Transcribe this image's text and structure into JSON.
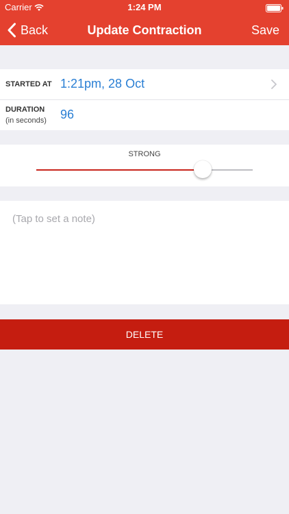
{
  "status_bar": {
    "carrier": "Carrier",
    "time": "1:24 PM"
  },
  "nav": {
    "back_label": "Back",
    "title": "Update Contraction",
    "save_label": "Save"
  },
  "contraction": {
    "started_label": "STARTED AT",
    "started_value": "1:21pm, 28 Oct",
    "duration_label": "DURATION",
    "duration_sublabel": "(in seconds)",
    "duration_value": "96"
  },
  "intensity": {
    "label": "STRONG",
    "level": 0.77
  },
  "note": {
    "placeholder": "(Tap to set a note)"
  },
  "delete_label": "DELETE",
  "colors": {
    "nav_background": "#e4412f",
    "accent_blue": "#2a7fd4",
    "delete_red": "#c51d10",
    "slider_fill": "#c8241b",
    "background": "#efeff4"
  },
  "icons": {
    "back": "chevron-left-icon",
    "wifi": "wifi-icon",
    "battery": "battery-icon",
    "disclosure": "chevron-right-icon"
  }
}
